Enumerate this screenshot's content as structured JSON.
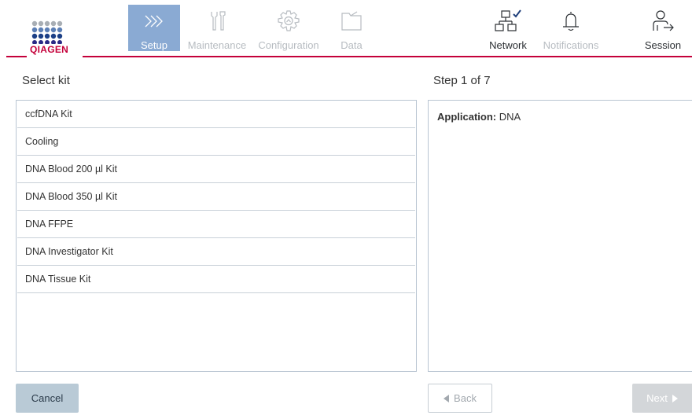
{
  "brand": {
    "name": "QIAGEN",
    "color": "#c4003a"
  },
  "nav": {
    "setup": {
      "label": "Setup",
      "icon": "chevrons-right-icon",
      "active": true
    },
    "maintenance": {
      "label": "Maintenance",
      "icon": "tools-icon"
    },
    "configuration": {
      "label": "Configuration",
      "icon": "gear-icon"
    },
    "data": {
      "label": "Data",
      "icon": "folder-icon"
    },
    "network": {
      "label": "Network",
      "icon": "network-connected-icon"
    },
    "notifications": {
      "label": "Notifications",
      "icon": "bell-icon"
    },
    "session": {
      "label": "Session",
      "icon": "user-logout-icon"
    }
  },
  "left": {
    "heading": "Select kit",
    "kits": [
      "ccfDNA Kit",
      "Cooling",
      "DNA Blood 200 µl Kit",
      "DNA Blood 350 µl Kit",
      "DNA FFPE",
      "DNA Investigator Kit",
      "DNA Tissue Kit"
    ]
  },
  "right": {
    "heading": "Step 1 of 7",
    "application_label": "Application:",
    "application_value": "DNA"
  },
  "buttons": {
    "cancel": "Cancel",
    "back": "Back",
    "next": "Next"
  },
  "colors": {
    "active_tab": "#8aaad3",
    "cancel_bg": "#b9cad6",
    "next_disabled_bg": "#d3d6d9"
  }
}
